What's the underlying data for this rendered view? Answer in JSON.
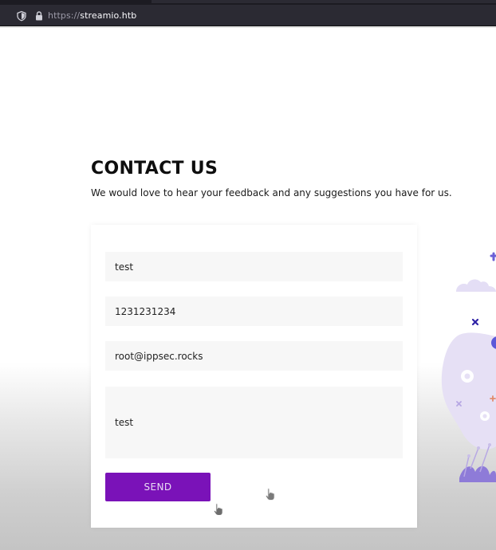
{
  "browser": {
    "url_protocol": "https://",
    "url_host": "streamio.htb"
  },
  "contact": {
    "title": "CONTACT US",
    "subtitle": "We would love to hear your feedback and any suggestions you have for us.",
    "fields": {
      "name": "test",
      "phone": "1231231234",
      "email": "root@ippsec.rocks",
      "message": "test"
    },
    "send_label": "SEND"
  },
  "colors": {
    "accent": "#7a12b8",
    "illustration": "#e6dff7",
    "illustration_dark": "#3b2bb3"
  }
}
